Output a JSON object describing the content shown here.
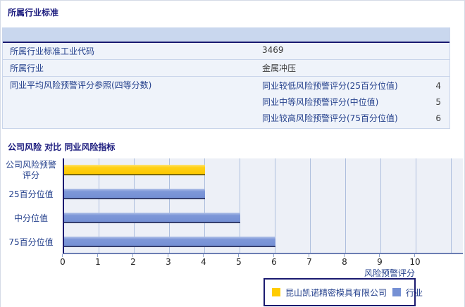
{
  "page": {
    "section1_title": "所属行业标准",
    "section2_title": "公司风险 对比 同业风险指标"
  },
  "industry_table": {
    "rows": [
      {
        "label": "所属行业标准工业代码",
        "value": "3469"
      },
      {
        "label": "所属行业",
        "value": "金属冲压"
      }
    ],
    "peer_row": {
      "label": "同业平均风险预警评分参照(四等分数)",
      "items": [
        {
          "label": "同业较低风险预警评分(25百分位值)",
          "value": "4"
        },
        {
          "label": "同业中等风险预警评分(中位值)",
          "value": "5"
        },
        {
          "label": "同业较高风险预警评分(75百分位值)",
          "value": "6"
        }
      ]
    }
  },
  "chart_data": {
    "type": "bar",
    "orientation": "horizontal",
    "title": "公司风险 对比 同业风险指标",
    "categories": [
      "公司风险预警评分",
      "25百分位值",
      "中分位值",
      "75百分位值"
    ],
    "series": [
      {
        "name": "昆山凯诺精密模具有限公司",
        "color": "#ffcc00",
        "data": [
          {
            "category": "公司风险预警评分",
            "value": 4
          }
        ]
      },
      {
        "name": "行业",
        "color": "#7590d4",
        "data": [
          {
            "category": "25百分位值",
            "value": 4
          },
          {
            "category": "中分位值",
            "value": 5
          },
          {
            "category": "75百分位值",
            "value": 6
          }
        ]
      }
    ],
    "xlabel": "风险预警评分",
    "xlim": [
      0,
      10
    ],
    "xticks": [
      "0",
      "1",
      "2",
      "3",
      "4",
      "5",
      "6",
      "7",
      "8",
      "9",
      "10"
    ],
    "grid": true,
    "legend_position": "bottom-right",
    "colors": {
      "plot_bg": "#edf0f7",
      "gridline": "#aebfde",
      "company_bar": "#ffcc00",
      "industry_bar": "#7590d4"
    }
  }
}
